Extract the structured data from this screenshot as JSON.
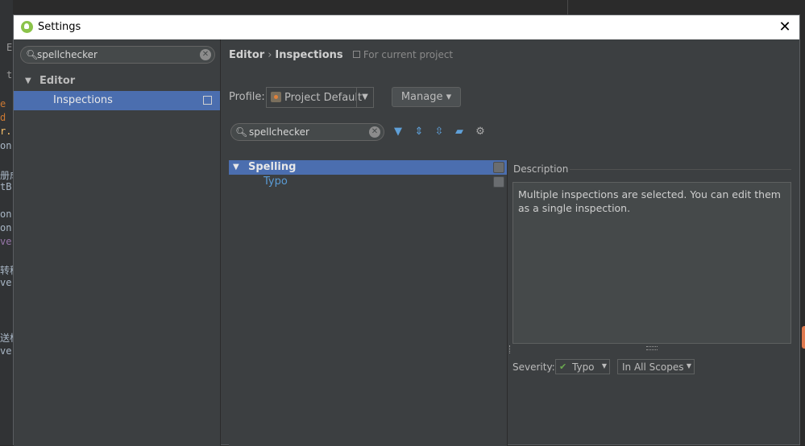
{
  "background_editor": {
    "lines": [
      {
        "text": "E",
        "color": "#9a9a9a"
      },
      {
        "text": "t",
        "color": "#9a9a9a"
      },
      {
        "text": "e",
        "color": "#cc7832"
      },
      {
        "text": "d",
        "color": "#cc7832"
      },
      {
        "text": "r.",
        "color": "#ffc66d"
      },
      {
        "text": "on",
        "color": "#a9b7c6"
      },
      {
        "text": "册成",
        "color": "#a9b7c6"
      },
      {
        "text": "tB",
        "color": "#a9b7c6"
      },
      {
        "text": "on",
        "color": "#a9b7c6"
      },
      {
        "text": "on",
        "color": "#a9b7c6"
      },
      {
        "text": "ve",
        "color": "#9876aa"
      },
      {
        "text": "转移",
        "color": "#a9b7c6"
      },
      {
        "text": "ve",
        "color": "#a9b7c6"
      },
      {
        "text": "送标",
        "color": "#a9b7c6"
      },
      {
        "text": "ve",
        "color": "#a9b7c6"
      }
    ]
  },
  "dialog": {
    "title": "Settings",
    "close_glyph": "✕"
  },
  "left": {
    "search": {
      "value": "spellchecker",
      "icon": "search-icon"
    },
    "tree": {
      "editor_label": "Editor",
      "inspections_label": "Inspections"
    }
  },
  "header": {
    "crumb1": "Editor",
    "sep": "›",
    "crumb2": "Inspections",
    "scope": "For current project"
  },
  "profile": {
    "label": "Profile:",
    "value": "Project Default",
    "manage_label": "Manage ▾"
  },
  "filter": {
    "value": "spellchecker"
  },
  "toolbar": {
    "filter_icon": "filter-icon",
    "expand_icon": "expand-all-icon",
    "collapse_icon": "collapse-all-icon",
    "reset_icon": "reset-icon",
    "settings_icon": "gear-icon"
  },
  "inspection_tree": {
    "group_label": "Spelling",
    "child_label": "Typo"
  },
  "description": {
    "label": "Description",
    "text": "Multiple inspections are selected. You can edit them as a single inspection."
  },
  "severity": {
    "label": "Severity:",
    "value": "Typo",
    "scope_value": "In All Scopes"
  },
  "colors": {
    "selection": "#4b6eaf",
    "panel": "#3c3f41",
    "link": "#5a9bd5"
  }
}
